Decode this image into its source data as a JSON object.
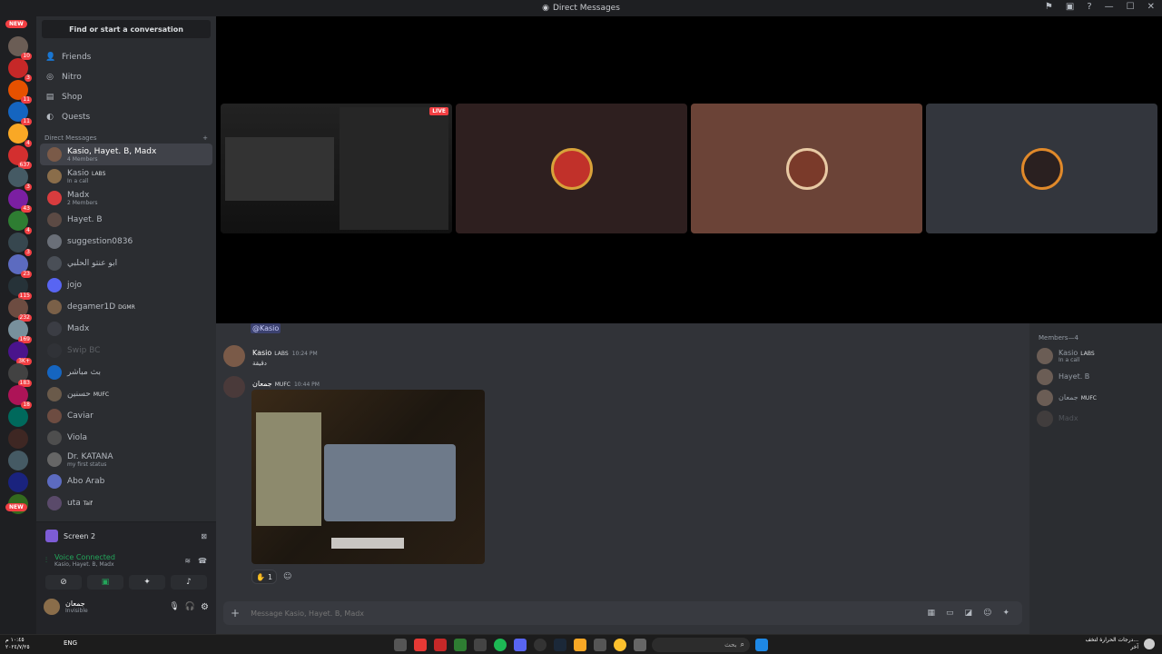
{
  "window": {
    "title": "Direct Messages"
  },
  "guilds": {
    "new_label": "NEW",
    "badges": [
      "10",
      "3",
      "11",
      "11",
      "4",
      "637",
      "3",
      "43",
      "4",
      "3",
      "23",
      "115",
      "232",
      "169",
      "3K+",
      "183",
      "18"
    ]
  },
  "sidebar": {
    "search_label": "Find or start a conversation",
    "nav": [
      {
        "label": "Friends",
        "icon": "friends-icon"
      },
      {
        "label": "Nitro",
        "icon": "nitro-icon"
      },
      {
        "label": "Shop",
        "icon": "shop-icon"
      },
      {
        "label": "Quests",
        "icon": "quests-icon"
      }
    ],
    "dm_header": "Direct Messages",
    "dms": [
      {
        "name": "Kasio, Hayet. B, Madx",
        "sub": "4 Members",
        "active": true
      },
      {
        "name": "Kasio",
        "tag": "LABS",
        "sub": "In a call"
      },
      {
        "name": "Madx",
        "sub": "2 Members"
      },
      {
        "name": "Hayet. B",
        "sub": ""
      },
      {
        "name": "suggestion0836",
        "sub": ""
      },
      {
        "name": "ابو عنتو الحلبي",
        "sub": ""
      },
      {
        "name": "jojo",
        "sub": ""
      },
      {
        "name": "degamer1D",
        "tag": "DGMR",
        "sub": ""
      },
      {
        "name": "Madx",
        "sub": ""
      },
      {
        "name": "Swip BC",
        "sub": ""
      },
      {
        "name": "بث مباشر",
        "sub": ""
      },
      {
        "name": "حسنين",
        "tag": "MUFC",
        "sub": ""
      },
      {
        "name": "Caviar",
        "sub": ""
      },
      {
        "name": "Viola",
        "sub": ""
      },
      {
        "name": "Dr. KATANA",
        "sub": "my first status"
      },
      {
        "name": "Abo Arab",
        "sub": ""
      },
      {
        "name": "uta",
        "tag": "Taif",
        "sub": ""
      }
    ]
  },
  "call_panel": {
    "screen_label": "Screen 2",
    "voice_status": "Voice Connected",
    "voice_members": "Kasio, Hayet. B, Madx",
    "user_name": "جمعان",
    "user_status": "Invisible"
  },
  "stage": {
    "live_label": "LIVE"
  },
  "chat": {
    "mention": "@Kasio",
    "messages": [
      {
        "author": "Kasio",
        "tag": "LABS",
        "time": "10:24 PM",
        "text": "دقيقة"
      },
      {
        "author": "جمعان",
        "tag": "MUFC",
        "time": "10:44 PM",
        "text": ""
      }
    ],
    "reaction_count": "1",
    "composer_placeholder": "Message Kasio, Hayet. B, Madx"
  },
  "members": {
    "header": "Members—4",
    "list": [
      {
        "name": "Kasio",
        "tag": "LABS",
        "sub": "In a call"
      },
      {
        "name": "Hayet. B",
        "tag": "",
        "sub": ""
      },
      {
        "name": "جمعان",
        "tag": "MUFC",
        "sub": ""
      },
      {
        "name": "Madx",
        "tag": "",
        "sub": ""
      }
    ]
  },
  "taskbar": {
    "lang": "ENG",
    "search_placeholder": "بحث",
    "weather": "درجات الحرارة لتخف...",
    "weather_sub": "آخر",
    "time": "١٠:٤٥ م",
    "date": "٢٠٢٤/٧/٢٥"
  },
  "colors": {
    "accent": "#5865f2",
    "voice_green": "#23a55a",
    "danger": "#f23f43"
  }
}
